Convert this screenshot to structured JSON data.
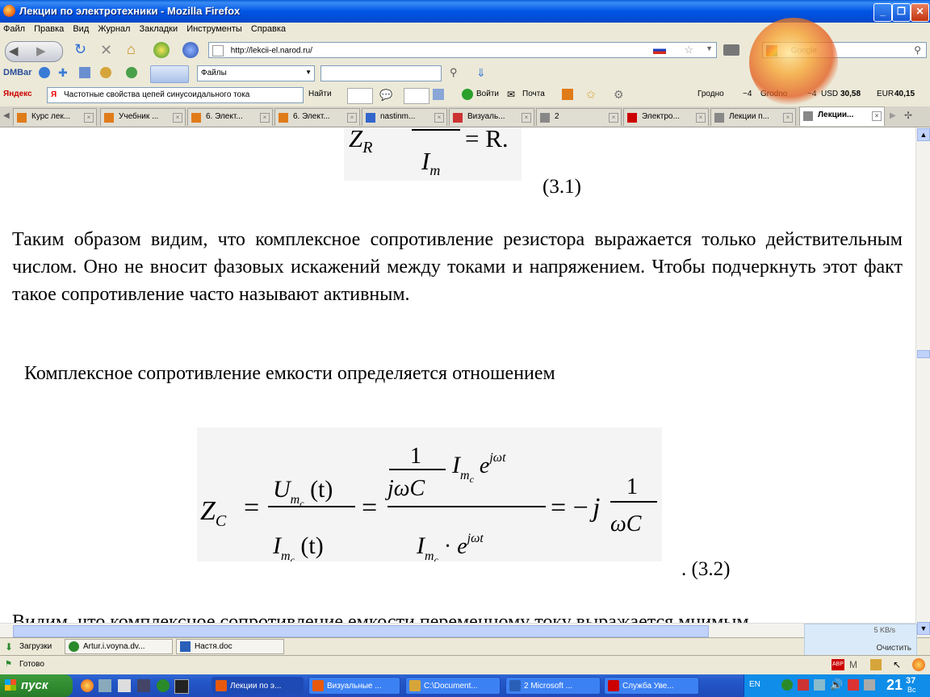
{
  "window": {
    "title": "Лекции по электротехники - Mozilla Firefox"
  },
  "menu": [
    "Файл",
    "Правка",
    "Вид",
    "Журнал",
    "Закладки",
    "Инструменты",
    "Справка"
  ],
  "nav": {
    "url": "http://lekcii-el.narod.ru/",
    "search_placeholder": "Google"
  },
  "toolbar2": {
    "brand": "DMBar",
    "files": "Файлы"
  },
  "yandex": {
    "brand": "Яндекс",
    "query": "Частотные свойства цепей синусоидального тока",
    "find": "Найти",
    "login": "Войти",
    "mail": "Почта",
    "city": "Гродно",
    "temp1": "−4",
    "city2": "Grodno",
    "temp2": "−4",
    "usd_label": "USD",
    "usd": "30,58",
    "eur_label": "EUR",
    "eur": "40,15"
  },
  "tabs": [
    {
      "label": "Курс лек...",
      "active": false,
      "color": "#e07b1a"
    },
    {
      "label": "Учебник ...",
      "active": false,
      "color": "#e07b1a"
    },
    {
      "label": "6. Элект...",
      "active": false,
      "color": "#e07b1a"
    },
    {
      "label": "6. Элект...",
      "active": false,
      "color": "#e07b1a"
    },
    {
      "label": "nastinm...",
      "active": false,
      "color": "#3366cc"
    },
    {
      "label": "Визуаль...",
      "active": false,
      "color": "#cc3333"
    },
    {
      "label": "2",
      "active": false,
      "color": "#888888"
    },
    {
      "label": "Электро...",
      "active": false,
      "color": "#cc0000"
    },
    {
      "label": "Лекции п...",
      "active": false,
      "color": "#888888"
    },
    {
      "label": "Лекции...",
      "active": true,
      "color": "#888888"
    }
  ],
  "content": {
    "eq1_label": "(3.1)",
    "eq1_z": "Z",
    "eq1_sub": "R",
    "eq1_rhs": "= R.",
    "eq1_den": "I",
    "eq1_den_sub": "m",
    "para1": "Таким образом видим, что комплексное сопротивление резистора выражается только действительным числом. Оно не вносит фазовых искажений между токами и напряжением. Чтобы подчеркнуть этот факт такое сопротивление часто называют активным.",
    "para2": "Комплексное сопротивление емкости определяется отношением",
    "eq2_label": ". (3.2)",
    "para3": "Видим, что комплексное сопротивление емкости переменному току выражается мнимым"
  },
  "downloads": {
    "label": "Загрузки",
    "items": [
      "Artur.i.voyna.dv...",
      "Настя.doc"
    ],
    "speed": "5 KB/s",
    "clear": "Очистить"
  },
  "status": {
    "text": "Готово"
  },
  "taskbar": {
    "start": "пуск",
    "tasks": [
      "Лекции по э...",
      "Визуальные ...",
      "C:\\Document...",
      "2 Microsoft ...",
      "Служба Уве..."
    ],
    "lang": "EN",
    "clock": "21",
    "clock_min": "37",
    "clock_day": "Вс"
  }
}
